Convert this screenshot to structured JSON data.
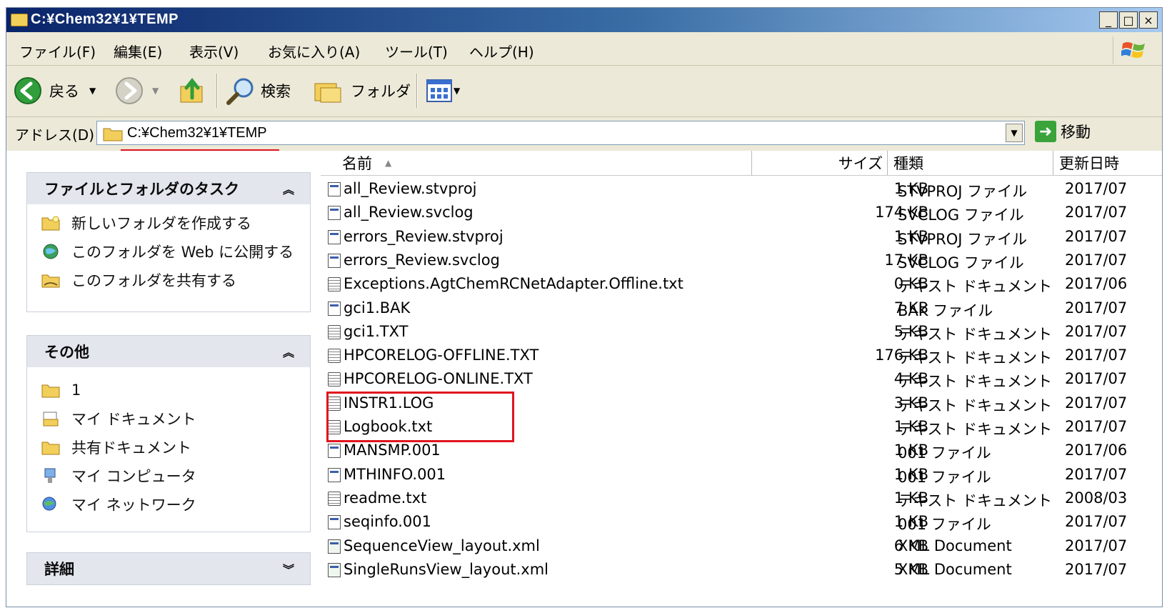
{
  "window": {
    "title": "C:¥Chem32¥1¥TEMP",
    "buttons": {
      "minimize": "_",
      "maximize": "□",
      "close": "×"
    }
  },
  "menu": [
    {
      "label": "ファイル(F)"
    },
    {
      "label": "編集(E)"
    },
    {
      "label": "表示(V)"
    },
    {
      "label": "お気に入り(A)"
    },
    {
      "label": "ツール(T)"
    },
    {
      "label": "ヘルプ(H)"
    }
  ],
  "toolbar": {
    "back_label": "戻る",
    "search_label": "検索",
    "folder_label": "フォルダ"
  },
  "address": {
    "label": "アドレス(D)",
    "value": "C:¥Chem32¥1¥TEMP",
    "go_label": "移動"
  },
  "left_pane": {
    "tasks": {
      "title": "ファイルとフォルダのタスク",
      "items": [
        {
          "label": "新しいフォルダを作成する",
          "icon": "new-folder-icon"
        },
        {
          "label": "このフォルダを Web に公開する",
          "icon": "publish-web-icon"
        },
        {
          "label": "このフォルダを共有する",
          "icon": "share-folder-icon"
        }
      ]
    },
    "other": {
      "title": "その他",
      "items": [
        {
          "label": "1",
          "icon": "folder-icon"
        },
        {
          "label": "マイ ドキュメント",
          "icon": "my-documents-icon"
        },
        {
          "label": "共有ドキュメント",
          "icon": "shared-folder-icon"
        },
        {
          "label": "マイ コンピュータ",
          "icon": "my-computer-icon"
        },
        {
          "label": "マイ ネットワーク",
          "icon": "network-icon"
        }
      ]
    },
    "details": {
      "title": "詳細"
    }
  },
  "columns": {
    "name": "名前",
    "size": "サイズ",
    "type": "種類",
    "modified": "更新日時"
  },
  "files": [
    {
      "name": "all_Review.stvproj",
      "size": "1 KB",
      "type": "STVPROJ ファイル",
      "date": "2017/07",
      "icon": "bin"
    },
    {
      "name": "all_Review.svclog",
      "size": "174 KB",
      "type": "SVCLOG ファイル",
      "date": "2017/07",
      "icon": "bin"
    },
    {
      "name": "errors_Review.stvproj",
      "size": "1 KB",
      "type": "STVPROJ ファイル",
      "date": "2017/07",
      "icon": "bin"
    },
    {
      "name": "errors_Review.svclog",
      "size": "17 KB",
      "type": "SVCLOG ファイル",
      "date": "2017/07",
      "icon": "bin"
    },
    {
      "name": "Exceptions.AgtChemRCNetAdapter.Offline.txt",
      "size": "0 KB",
      "type": "テキスト ドキュメント",
      "date": "2017/06",
      "icon": "txt"
    },
    {
      "name": "gci1.BAK",
      "size": "7 KB",
      "type": "BAK ファイル",
      "date": "2017/07",
      "icon": "bin"
    },
    {
      "name": "gci1.TXT",
      "size": "5 KB",
      "type": "テキスト ドキュメント",
      "date": "2017/07",
      "icon": "txt"
    },
    {
      "name": "HPCORELOG-OFFLINE.TXT",
      "size": "176 KB",
      "type": "テキスト ドキュメント",
      "date": "2017/07",
      "icon": "txt"
    },
    {
      "name": "HPCORELOG-ONLINE.TXT",
      "size": "4 KB",
      "type": "テキスト ドキュメント",
      "date": "2017/07",
      "icon": "txt"
    },
    {
      "name": "INSTR1.LOG",
      "size": "3 KB",
      "type": "テキスト ドキュメント",
      "date": "2017/07",
      "icon": "txt"
    },
    {
      "name": "Logbook.txt",
      "size": "1 KB",
      "type": "テキスト ドキュメント",
      "date": "2017/07",
      "icon": "txt"
    },
    {
      "name": "MANSMP.001",
      "size": "1 KB",
      "type": "001 ファイル",
      "date": "2017/06",
      "icon": "bin"
    },
    {
      "name": "MTHINFO.001",
      "size": "1 KB",
      "type": "001 ファイル",
      "date": "2017/07",
      "icon": "bin"
    },
    {
      "name": "readme.txt",
      "size": "1 KB",
      "type": "テキスト ドキュメント",
      "date": "2008/03",
      "icon": "txt"
    },
    {
      "name": "seqinfo.001",
      "size": "1 KB",
      "type": "001 ファイル",
      "date": "2017/07",
      "icon": "bin"
    },
    {
      "name": "SequenceView_layout.xml",
      "size": "6 KB",
      "type": "XML Document",
      "date": "2017/07",
      "icon": "xml"
    },
    {
      "name": "SingleRunsView_layout.xml",
      "size": "5 KB",
      "type": "XML Document",
      "date": "2017/07",
      "icon": "xml"
    }
  ]
}
